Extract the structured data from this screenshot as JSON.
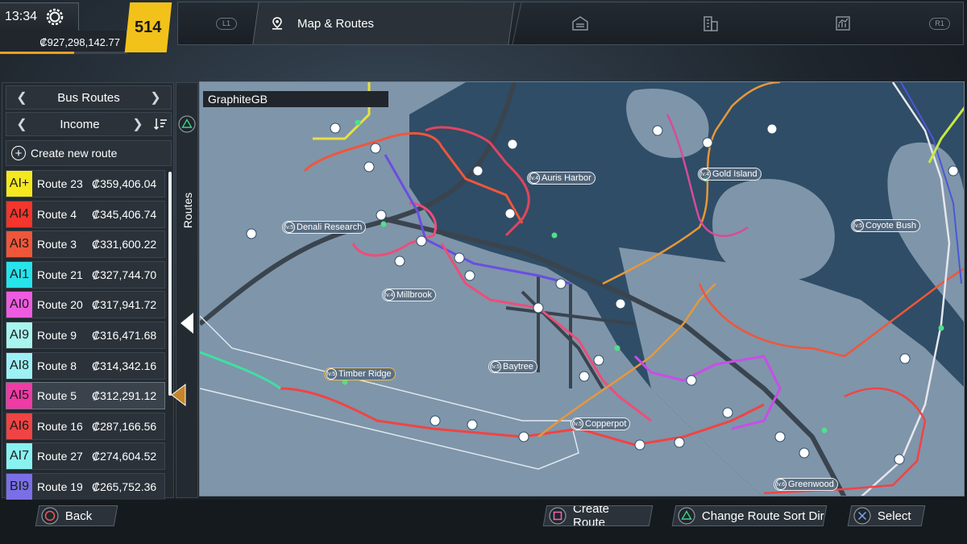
{
  "status": {
    "time": "13:34",
    "money": "₡927,298,142.77",
    "level": "514",
    "level_progress": 0.58
  },
  "nav": {
    "left_bumper": "L1",
    "right_bumper": "R1",
    "active_tab": "Map & Routes",
    "icons": [
      "map-pin-icon",
      "depot-icon",
      "office-building-icon",
      "statistics-icon"
    ]
  },
  "panel": {
    "category": "Bus Routes",
    "sort_by": "Income",
    "create_label": "Create new route",
    "tab_label": "Routes",
    "routes": [
      {
        "code": "AI+",
        "name": "Route 23",
        "income": "₡359,406.04",
        "color": "#f5e81e"
      },
      {
        "code": "AI4",
        "name": "Route 4",
        "income": "₡345,406.74",
        "color": "#f4362c"
      },
      {
        "code": "AI3",
        "name": "Route 3",
        "income": "₡331,600.22",
        "color": "#f0563a"
      },
      {
        "code": "AI1",
        "name": "Route 21",
        "income": "₡327,744.70",
        "color": "#27e3ea"
      },
      {
        "code": "AI0",
        "name": "Route 20",
        "income": "₡317,941.72",
        "color": "#ee5be0"
      },
      {
        "code": "AI9",
        "name": "Route 9",
        "income": "₡316,471.68",
        "color": "#a8f4ef"
      },
      {
        "code": "AI8",
        "name": "Route 8",
        "income": "₡314,342.16",
        "color": "#9cf1f5"
      },
      {
        "code": "AI5",
        "name": "Route 5",
        "income": "₡312,291.12",
        "color": "#f03aa6"
      },
      {
        "code": "AI6",
        "name": "Route 16",
        "income": "₡287,166.56",
        "color": "#f04444"
      },
      {
        "code": "AI7",
        "name": "Route 27",
        "income": "₡274,604.52",
        "color": "#88f2f0"
      },
      {
        "code": "BI9",
        "name": "Route 19",
        "income": "₡265,752.36",
        "color": "#7a6fe6"
      }
    ]
  },
  "map": {
    "company": "GraphiteGB",
    "places": [
      {
        "level": "lv.4",
        "name": "Auris Harbor",
        "gold": false
      },
      {
        "level": "lv.4",
        "name": "Gold Island",
        "gold": false
      },
      {
        "level": "lv.5",
        "name": "Denali Research",
        "gold": false
      },
      {
        "level": "lv.5",
        "name": "Coyote Bush",
        "gold": false
      },
      {
        "level": "lv.4",
        "name": "Millbrook",
        "gold": false
      },
      {
        "level": "lv.5",
        "name": "Timber Ridge",
        "gold": true
      },
      {
        "level": "lv.5",
        "name": "Baytree",
        "gold": false
      },
      {
        "level": "lv.5",
        "name": "Copperpot",
        "gold": false
      },
      {
        "level": "lv.6",
        "name": "Greenwood",
        "gold": false
      }
    ]
  },
  "hints": {
    "back": "Back",
    "create": "Create Route",
    "sort": "Change Route Sort Direction",
    "select": "Select"
  }
}
